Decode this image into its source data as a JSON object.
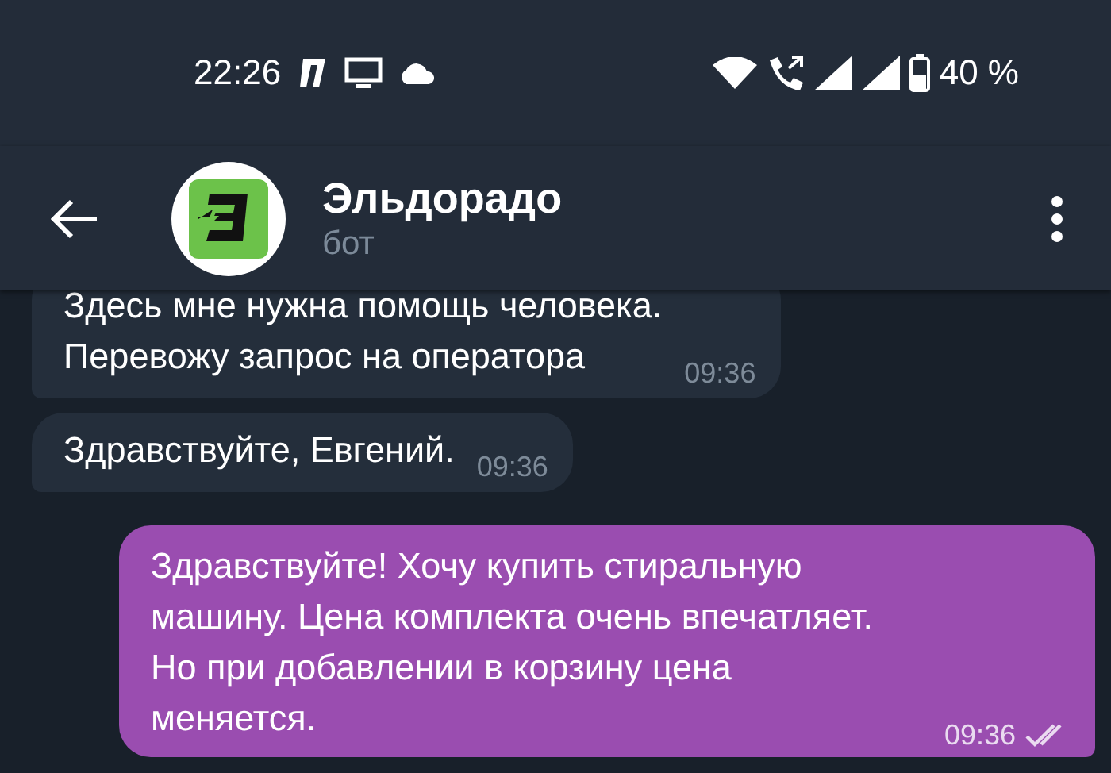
{
  "status_bar": {
    "time": "22:26",
    "battery": "40 %"
  },
  "header": {
    "title": "Эльдорадо",
    "subtitle": "бот"
  },
  "messages": [
    {
      "kind": "incoming",
      "text": "Здесь мне нужна помощь человека.\nПеревожу запрос на оператора",
      "time": "09:36"
    },
    {
      "kind": "incoming",
      "text": "Здравствуйте, Евгений.",
      "time": "09:36"
    },
    {
      "kind": "outgoing",
      "text": "Здравствуйте! Хочу купить стиральную машину. Цена комплекта очень впечатляет. Но при добавлении в корзину цена меняется.",
      "time": "09:36",
      "read": true
    }
  ]
}
